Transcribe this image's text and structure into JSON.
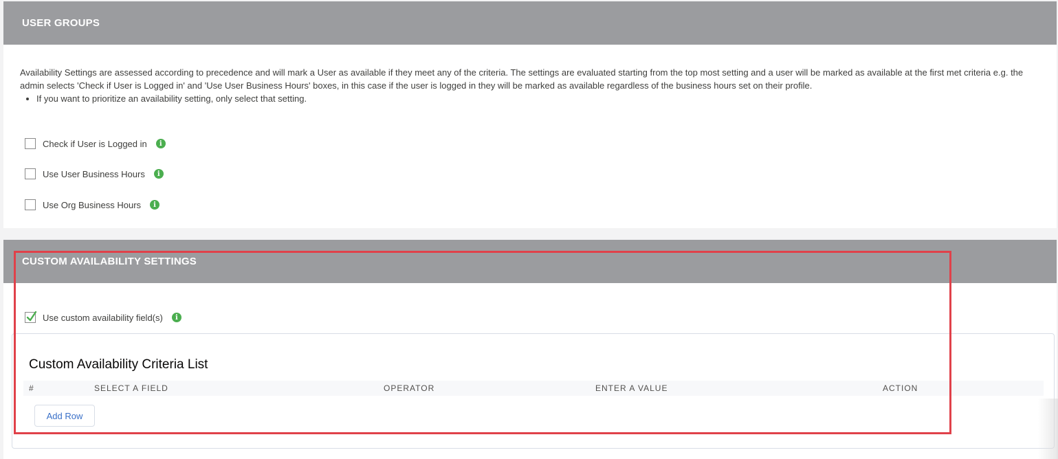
{
  "user_groups": {
    "title": "USER GROUPS",
    "description": "Availability Settings are assessed according to precedence and will mark a User as available if they meet any of the criteria. The settings are evaluated starting from the top most setting and a user will be marked as available at the first met criteria e.g. the admin selects 'Check if User is Logged in' and 'Use User Business Hours' boxes, in this case if the user is logged in they will be marked as available regardless of the business hours set on their profile.",
    "bullet": "If you want to prioritize an availability setting, only select that setting.",
    "options": [
      {
        "label": "Check if User is Logged in",
        "checked": false
      },
      {
        "label": "Use User Business Hours",
        "checked": false
      },
      {
        "label": "Use Org Business Hours",
        "checked": false
      }
    ]
  },
  "custom_settings": {
    "title": "CUSTOM AVAILABILITY SETTINGS",
    "use_custom_label": "Use custom availability field(s)",
    "use_custom_checked": true,
    "criteria_list": {
      "title": "Custom Availability Criteria List",
      "columns": [
        "#",
        "SELECT A FIELD",
        "OPERATOR",
        "ENTER A VALUE",
        "ACTION"
      ],
      "add_row_label": "Add Row"
    }
  },
  "colors": {
    "header_bg": "#9b9c9f",
    "info_icon": "#4bae4f",
    "check_mark": "#4bae4f",
    "highlight": "#e0414a",
    "link_blue": "#3a70c8"
  },
  "icons": {
    "info": "info-icon",
    "check": "checkmark-icon"
  }
}
